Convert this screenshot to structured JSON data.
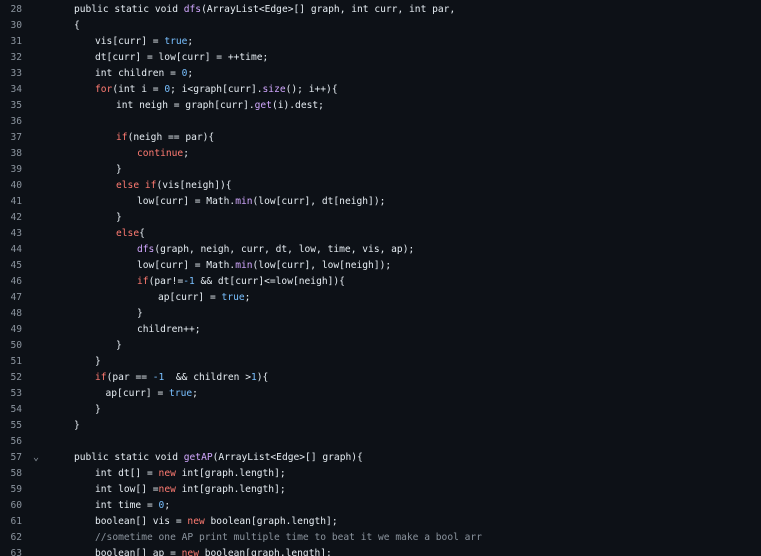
{
  "editor": {
    "lines": [
      {
        "num": "28",
        "indent": 0,
        "tokens": [
          {
            "t": "public static void ",
            "c": "tx"
          },
          {
            "t": "dfs",
            "c": "fn"
          },
          {
            "t": "(ArrayList<Edge>[] graph, int curr, int par,",
            "c": "tx"
          }
        ]
      },
      {
        "num": "30",
        "indent": 0,
        "tokens": [
          {
            "t": "{",
            "c": "tx"
          }
        ]
      },
      {
        "num": "31",
        "indent": 1,
        "tokens": [
          {
            "t": "vis[curr] = ",
            "c": "tx"
          },
          {
            "t": "true",
            "c": "num"
          },
          {
            "t": ";",
            "c": "tx"
          }
        ]
      },
      {
        "num": "32",
        "indent": 1,
        "tokens": [
          {
            "t": "dt[curr] = low[curr] = ++time;",
            "c": "tx"
          }
        ]
      },
      {
        "num": "33",
        "indent": 1,
        "tokens": [
          {
            "t": "int children = ",
            "c": "tx"
          },
          {
            "t": "0",
            "c": "num"
          },
          {
            "t": ";",
            "c": "tx"
          }
        ]
      },
      {
        "num": "34",
        "indent": 1,
        "tokens": [
          {
            "t": "for",
            "c": "kw"
          },
          {
            "t": "(int i = ",
            "c": "tx"
          },
          {
            "t": "0",
            "c": "num"
          },
          {
            "t": "; i<graph[curr].",
            "c": "tx"
          },
          {
            "t": "size",
            "c": "fn"
          },
          {
            "t": "(); i++){",
            "c": "tx"
          }
        ]
      },
      {
        "num": "35",
        "indent": 2,
        "tokens": [
          {
            "t": "int neigh = graph[curr].",
            "c": "tx"
          },
          {
            "t": "get",
            "c": "fn"
          },
          {
            "t": "(i).dest;",
            "c": "tx"
          }
        ]
      },
      {
        "num": "36",
        "indent": 0,
        "tokens": []
      },
      {
        "num": "37",
        "indent": 2,
        "tokens": [
          {
            "t": "if",
            "c": "kw"
          },
          {
            "t": "(neigh == par){",
            "c": "tx"
          }
        ]
      },
      {
        "num": "38",
        "indent": 3,
        "tokens": [
          {
            "t": "continue",
            "c": "kw"
          },
          {
            "t": ";",
            "c": "tx"
          }
        ]
      },
      {
        "num": "39",
        "indent": 2,
        "tokens": [
          {
            "t": "}",
            "c": "tx"
          }
        ]
      },
      {
        "num": "40",
        "indent": 2,
        "tokens": [
          {
            "t": "else if",
            "c": "kw"
          },
          {
            "t": "(vis[neigh]){",
            "c": "tx"
          }
        ]
      },
      {
        "num": "41",
        "indent": 3,
        "tokens": [
          {
            "t": "low[curr] = Math.",
            "c": "tx"
          },
          {
            "t": "min",
            "c": "fn"
          },
          {
            "t": "(low[curr], dt[neigh]);",
            "c": "tx"
          }
        ]
      },
      {
        "num": "42",
        "indent": 2,
        "tokens": [
          {
            "t": "}",
            "c": "tx"
          }
        ]
      },
      {
        "num": "43",
        "indent": 2,
        "tokens": [
          {
            "t": "else",
            "c": "kw"
          },
          {
            "t": "{",
            "c": "tx"
          }
        ]
      },
      {
        "num": "44",
        "indent": 3,
        "tokens": [
          {
            "t": "dfs",
            "c": "fn"
          },
          {
            "t": "(graph, neigh, curr, dt, low, time, vis, ap);",
            "c": "tx"
          }
        ]
      },
      {
        "num": "45",
        "indent": 3,
        "tokens": [
          {
            "t": "low[curr] = Math.",
            "c": "tx"
          },
          {
            "t": "min",
            "c": "fn"
          },
          {
            "t": "(low[curr], low[neigh]);",
            "c": "tx"
          }
        ]
      },
      {
        "num": "46",
        "indent": 3,
        "tokens": [
          {
            "t": "if",
            "c": "kw"
          },
          {
            "t": "(par!=",
            "c": "tx"
          },
          {
            "t": "-1",
            "c": "num"
          },
          {
            "t": " && dt[curr]<=low[neigh]){",
            "c": "tx"
          }
        ]
      },
      {
        "num": "47",
        "indent": 4,
        "tokens": [
          {
            "t": "ap[curr] = ",
            "c": "tx"
          },
          {
            "t": "true",
            "c": "num"
          },
          {
            "t": ";",
            "c": "tx"
          }
        ]
      },
      {
        "num": "48",
        "indent": 3,
        "tokens": [
          {
            "t": "}",
            "c": "tx"
          }
        ]
      },
      {
        "num": "49",
        "indent": 3,
        "tokens": [
          {
            "t": "children++;",
            "c": "tx"
          }
        ]
      },
      {
        "num": "50",
        "indent": 2,
        "tokens": [
          {
            "t": "}",
            "c": "tx"
          }
        ]
      },
      {
        "num": "51",
        "indent": 1,
        "tokens": [
          {
            "t": "}",
            "c": "tx"
          }
        ]
      },
      {
        "num": "52",
        "indent": 1,
        "tokens": [
          {
            "t": "if",
            "c": "kw"
          },
          {
            "t": "(par == ",
            "c": "tx"
          },
          {
            "t": "-1",
            "c": "num"
          },
          {
            "t": "  && children >",
            "c": "tx"
          },
          {
            "t": "1",
            "c": "num"
          },
          {
            "t": "){",
            "c": "tx"
          }
        ]
      },
      {
        "num": "53",
        "indent": 1.5,
        "tokens": [
          {
            "t": "ap[curr] = ",
            "c": "tx"
          },
          {
            "t": "true",
            "c": "num"
          },
          {
            "t": ";",
            "c": "tx"
          }
        ]
      },
      {
        "num": "54",
        "indent": 1,
        "tokens": [
          {
            "t": "}",
            "c": "tx"
          }
        ]
      },
      {
        "num": "55",
        "indent": 0,
        "tokens": [
          {
            "t": "}",
            "c": "tx"
          }
        ]
      },
      {
        "num": "56",
        "indent": 0,
        "tokens": []
      },
      {
        "num": "57",
        "indent": 0,
        "fold": true,
        "tokens": [
          {
            "t": "public static void ",
            "c": "tx"
          },
          {
            "t": "getAP",
            "c": "fn"
          },
          {
            "t": "(ArrayList<Edge>[] graph){",
            "c": "tx"
          }
        ]
      },
      {
        "num": "58",
        "indent": 1,
        "tokens": [
          {
            "t": "int dt[] = ",
            "c": "tx"
          },
          {
            "t": "new",
            "c": "kw"
          },
          {
            "t": " int[graph.length];",
            "c": "tx"
          }
        ]
      },
      {
        "num": "59",
        "indent": 1,
        "tokens": [
          {
            "t": "int low[] =",
            "c": "tx"
          },
          {
            "t": "new",
            "c": "kw"
          },
          {
            "t": " int[graph.length];",
            "c": "tx"
          }
        ]
      },
      {
        "num": "60",
        "indent": 1,
        "tokens": [
          {
            "t": "int time = ",
            "c": "tx"
          },
          {
            "t": "0",
            "c": "num"
          },
          {
            "t": ";",
            "c": "tx"
          }
        ]
      },
      {
        "num": "61",
        "indent": 1,
        "tokens": [
          {
            "t": "boolean[] vis = ",
            "c": "tx"
          },
          {
            "t": "new",
            "c": "kw"
          },
          {
            "t": " boolean[graph.length];",
            "c": "tx"
          }
        ]
      },
      {
        "num": "62",
        "indent": 1,
        "tokens": [
          {
            "t": "//sometime one AP print multiple time to beat it we make a bool arr",
            "c": "cm"
          }
        ]
      },
      {
        "num": "63",
        "indent": 1,
        "tokens": [
          {
            "t": "boolean[] ap = ",
            "c": "tx"
          },
          {
            "t": "new",
            "c": "kw"
          },
          {
            "t": " boolean[graph.length];",
            "c": "tx"
          }
        ]
      }
    ]
  }
}
